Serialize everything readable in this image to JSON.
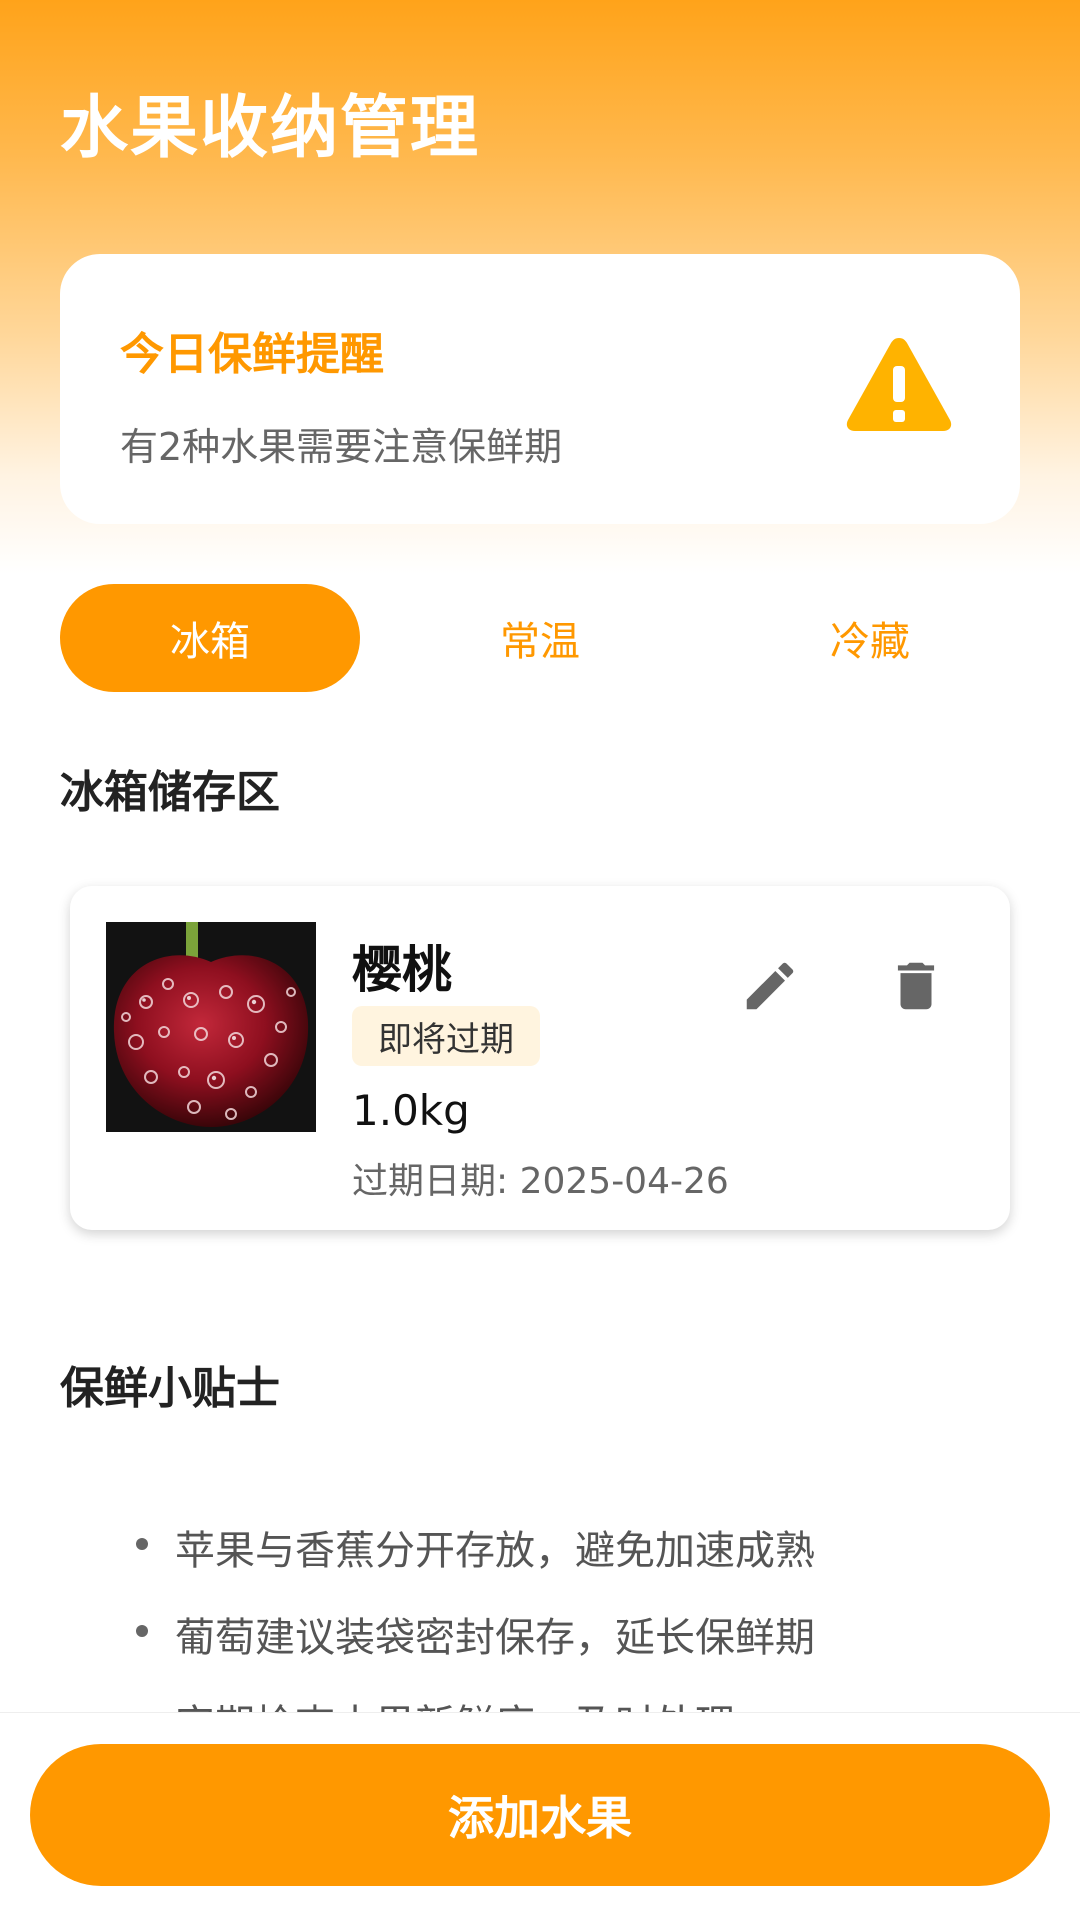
{
  "app": {
    "title": "水果收纳管理"
  },
  "reminder": {
    "title": "今日保鲜提醒",
    "subtitle": "有2种水果需要注意保鲜期",
    "icon": "warning-icon"
  },
  "tabs": [
    {
      "label": "冰箱",
      "active": true
    },
    {
      "label": "常温",
      "active": false
    },
    {
      "label": "冷藏",
      "active": false
    }
  ],
  "storage": {
    "section_title": "冰箱储存区",
    "items": [
      {
        "name": "樱桃",
        "badge": "即将过期",
        "weight": "1.0kg",
        "expiry": "过期日期: 2025-04-26",
        "image": "cherry-photo"
      }
    ]
  },
  "tips": {
    "section_title": "保鲜小贴士",
    "items": [
      "苹果与香蕉分开存放，避免加速成熟",
      "葡萄建议装袋密封保存，延长保鲜期",
      "定期检查水果新鲜度，及时处理"
    ]
  },
  "actions": {
    "add_label": "添加水果"
  },
  "colors": {
    "accent": "#FF9800",
    "warning": "#FFB300",
    "badge_bg": "#FFF4DF"
  }
}
